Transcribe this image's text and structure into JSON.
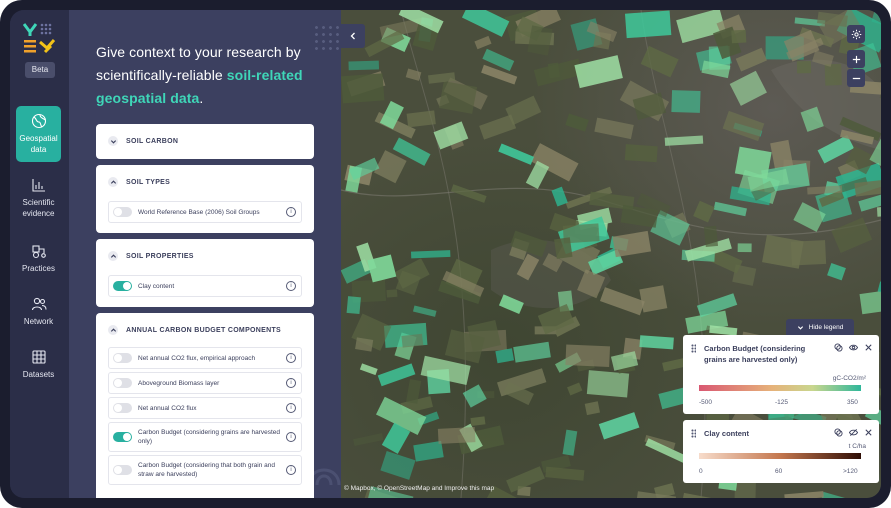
{
  "nav": {
    "beta": "Beta",
    "items": [
      {
        "label_1": "Geospatial",
        "label_2": "data",
        "icon": "globe-icon"
      },
      {
        "label_1": "Scientific",
        "label_2": "evidence",
        "icon": "bar-chart-icon"
      },
      {
        "label_1": "Practices",
        "icon": "tractor-icon"
      },
      {
        "label_1": "Network",
        "icon": "people-icon"
      },
      {
        "label_1": "Datasets",
        "icon": "table-grid-icon"
      }
    ]
  },
  "panel": {
    "headline_1": "Give context to your research by scientifically-reliable ",
    "headline_highlight": "soil-related geospatial data",
    "headline_end": "."
  },
  "sections": {
    "soil_carbon": {
      "title": "SOIL CARBON"
    },
    "soil_types": {
      "title": "SOIL TYPES",
      "layers": [
        {
          "label": "World Reference Base (2006) Soil Groups",
          "on": false
        }
      ]
    },
    "soil_properties": {
      "title": "SOIL PROPERTIES",
      "layers": [
        {
          "label": "Clay content",
          "on": true
        }
      ]
    },
    "carbon_budget": {
      "title": "ANNUAL CARBON BUDGET COMPONENTS",
      "layers": [
        {
          "label": "Net annual CO2 flux, empirical approach",
          "on": false
        },
        {
          "label": "Aboveground Biomass layer",
          "on": false
        },
        {
          "label": "Net annual CO2 flux",
          "on": false
        },
        {
          "label": "Carbon Budget (considering grains are harvested only)",
          "on": true
        },
        {
          "label": "Carbon Budget (considering that both grain and straw are harvested)",
          "on": false
        }
      ]
    }
  },
  "map": {
    "attribution": "© Mapbox, © OpenStreetMap and Improve this map",
    "hide_legend": "Hide legend",
    "legends": [
      {
        "title": "Carbon Budget (considering grains are harvested only)",
        "unit": "gC-CO2/m²",
        "ticks": [
          "-500",
          "-125",
          "350"
        ]
      },
      {
        "title": "Clay content",
        "unit": "t C/ha",
        "ticks": [
          "0",
          "60",
          ">120"
        ]
      }
    ]
  },
  "colors": {
    "accent": "#28b0a0",
    "highlight": "#3fd6b8",
    "panel": "#3c4060",
    "rail": "#2b2e48"
  }
}
